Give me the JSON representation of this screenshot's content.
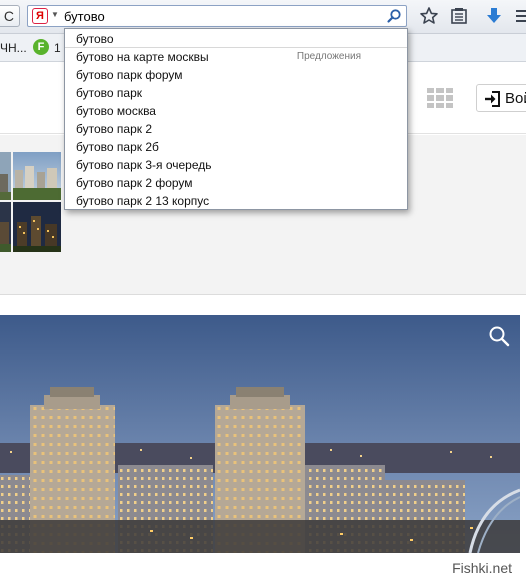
{
  "toolbar": {
    "reload_symbol": "C",
    "search_engine_logo": "Я",
    "url_value": "бутово",
    "icons": [
      "yandex-logo-icon",
      "search-icon",
      "star-icon",
      "bookmarks-list-icon",
      "download-icon",
      "menu-icon"
    ]
  },
  "bookmarks": {
    "partial_text": "ЧН...",
    "favicon_letter": "F",
    "partial_text_2": "1"
  },
  "suggestions": {
    "section_label": "Предложения",
    "items": [
      "бутово",
      "бутово на карте москвы",
      "бутово парк форум",
      "бутово парк",
      "бутово москва",
      "бутово парк 2",
      "бутово парк 2б",
      "бутово парк 3-я очередь",
      "бутово парк 2 форум",
      "бутово парк 2 13 корпус"
    ]
  },
  "page": {
    "login_label": "Вой",
    "watermark": "Fishki.net"
  },
  "colors": {
    "accent_blue": "#2b7cd3",
    "sky_top": "#3d5a8a",
    "sky_bottom": "#8aa3c6"
  }
}
